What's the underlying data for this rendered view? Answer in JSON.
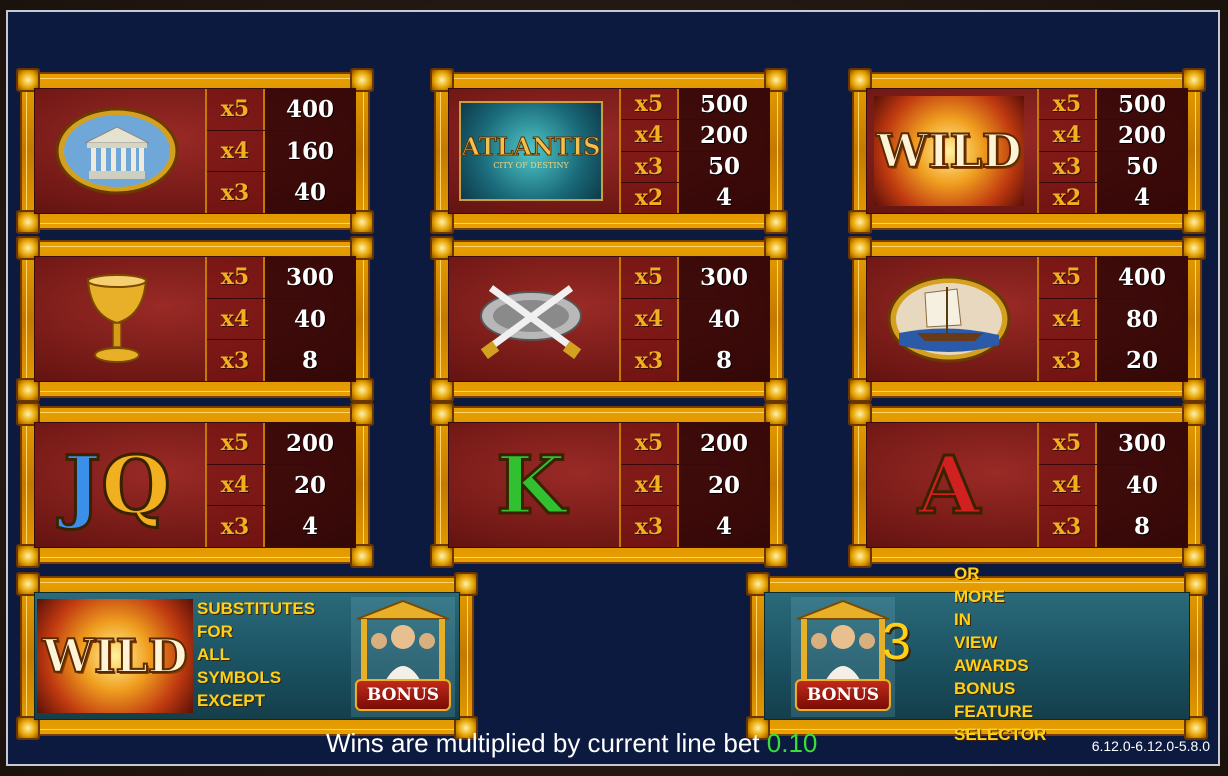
{
  "colors": {
    "background": "#0d1a40",
    "frame_gold": "#e8a000",
    "panel_red": "#7a1a18",
    "multiplier_text": "#f0b020",
    "info_text": "#ffd018",
    "bet_value": "#36e036"
  },
  "paytable": [
    {
      "symbol_icon": "temple-icon",
      "symbol_text": "",
      "pays": [
        {
          "x": "x5",
          "v": "400"
        },
        {
          "x": "x4",
          "v": "160"
        },
        {
          "x": "x3",
          "v": "40"
        }
      ]
    },
    {
      "symbol_icon": "atlantis-logo-icon",
      "symbol_text": "ATLANTIS",
      "symbol_subtext": "CITY OF DESTINY",
      "pays": [
        {
          "x": "x5",
          "v": "500"
        },
        {
          "x": "x4",
          "v": "200"
        },
        {
          "x": "x3",
          "v": "50"
        },
        {
          "x": "x2",
          "v": "4"
        }
      ]
    },
    {
      "symbol_icon": "wild-icon",
      "symbol_text": "WILD",
      "pays": [
        {
          "x": "x5",
          "v": "500"
        },
        {
          "x": "x4",
          "v": "200"
        },
        {
          "x": "x3",
          "v": "50"
        },
        {
          "x": "x2",
          "v": "4"
        }
      ]
    },
    {
      "symbol_icon": "chalice-icon",
      "symbol_text": "",
      "pays": [
        {
          "x": "x5",
          "v": "300"
        },
        {
          "x": "x4",
          "v": "40"
        },
        {
          "x": "x3",
          "v": "8"
        }
      ]
    },
    {
      "symbol_icon": "crossed-swords-shield-icon",
      "symbol_text": "",
      "pays": [
        {
          "x": "x5",
          "v": "300"
        },
        {
          "x": "x4",
          "v": "40"
        },
        {
          "x": "x3",
          "v": "8"
        }
      ]
    },
    {
      "symbol_icon": "ship-icon",
      "symbol_text": "",
      "pays": [
        {
          "x": "x5",
          "v": "400"
        },
        {
          "x": "x4",
          "v": "80"
        },
        {
          "x": "x3",
          "v": "20"
        }
      ]
    },
    {
      "symbol_icon": "letters-jq-icon",
      "symbol_text": "JQ",
      "pays": [
        {
          "x": "x5",
          "v": "200"
        },
        {
          "x": "x4",
          "v": "20"
        },
        {
          "x": "x3",
          "v": "4"
        }
      ]
    },
    {
      "symbol_icon": "letter-k-icon",
      "symbol_text": "K",
      "pays": [
        {
          "x": "x5",
          "v": "200"
        },
        {
          "x": "x4",
          "v": "20"
        },
        {
          "x": "x3",
          "v": "4"
        }
      ]
    },
    {
      "symbol_icon": "letter-a-icon",
      "symbol_text": "A",
      "pays": [
        {
          "x": "x5",
          "v": "300"
        },
        {
          "x": "x4",
          "v": "40"
        },
        {
          "x": "x3",
          "v": "8"
        }
      ]
    }
  ],
  "wild_info": {
    "symbol_text": "WILD",
    "lines": [
      "SUBSTITUTES",
      "FOR",
      "ALL",
      "SYMBOLS",
      "EXCEPT"
    ],
    "bonus_label": "BONUS"
  },
  "bonus_info": {
    "bonus_label": "BONUS",
    "count": "3",
    "lines": [
      "OR",
      "MORE",
      "IN",
      "VIEW",
      "AWARDS",
      "BONUS",
      "FEATURE",
      "SELECTOR"
    ]
  },
  "footer": {
    "text": "Wins are multiplied by current line bet",
    "bet": "0.10",
    "version": "6.12.0-6.12.0-5.8.0"
  }
}
